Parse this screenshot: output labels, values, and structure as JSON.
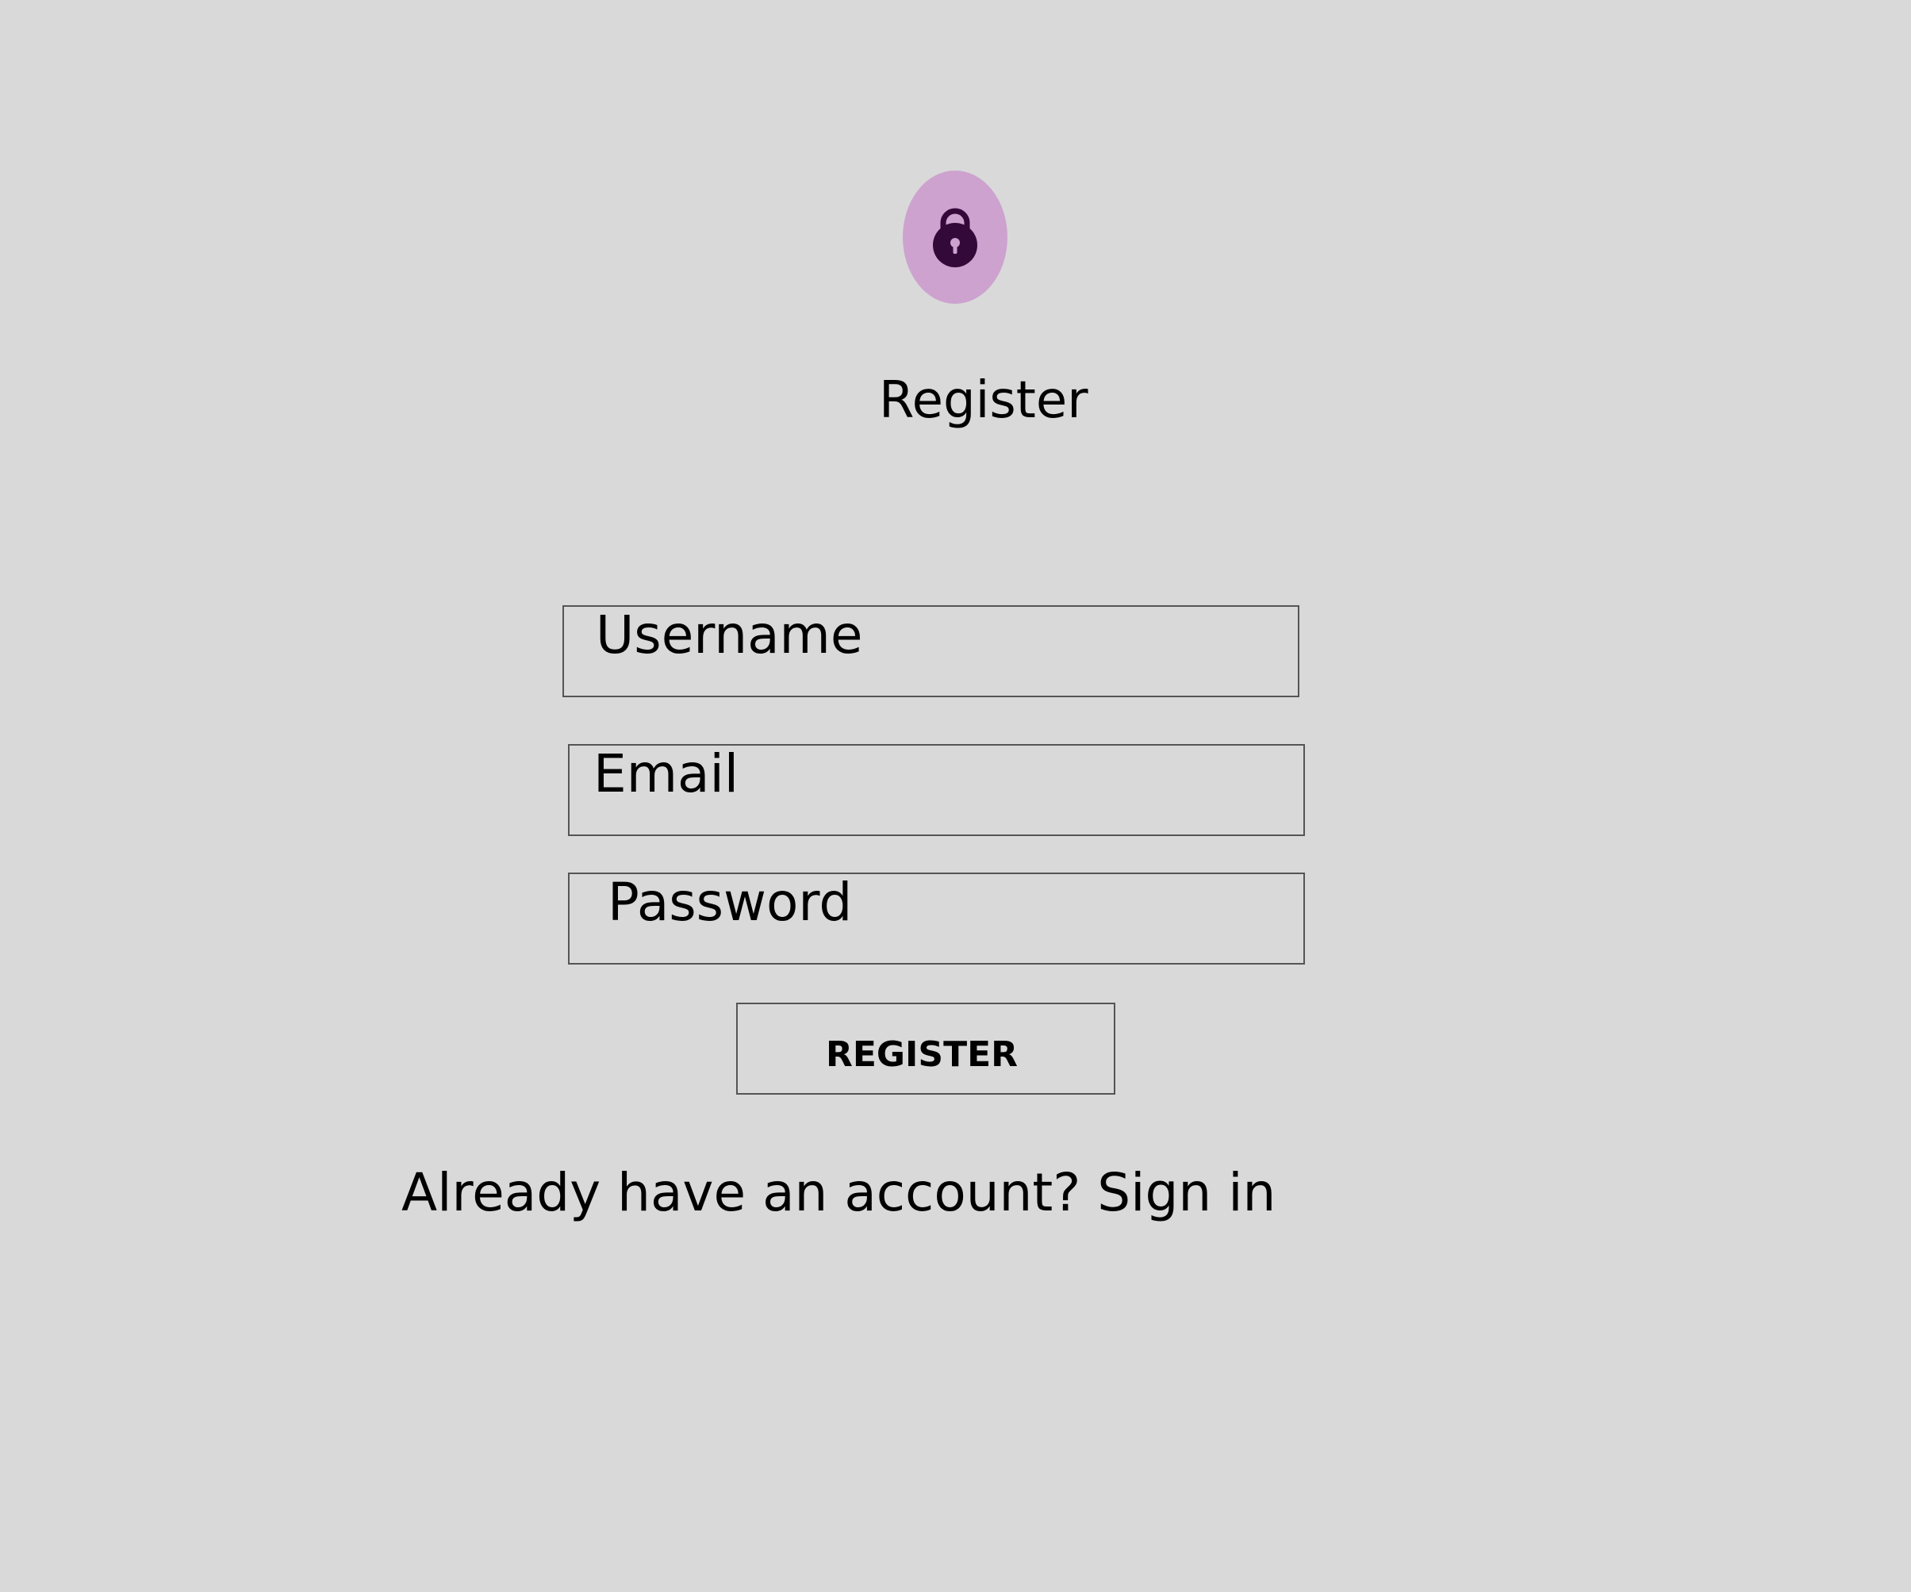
{
  "header": {
    "icon": "lock-icon",
    "avatar_color": "#cda2cf",
    "icon_color": "#33093a",
    "title": "Register"
  },
  "form": {
    "username_label": "Username",
    "email_label": "Email",
    "password_label": "Password",
    "submit_label": "REGISTER"
  },
  "footer": {
    "signin_text": "Already have an account? Sign in"
  }
}
